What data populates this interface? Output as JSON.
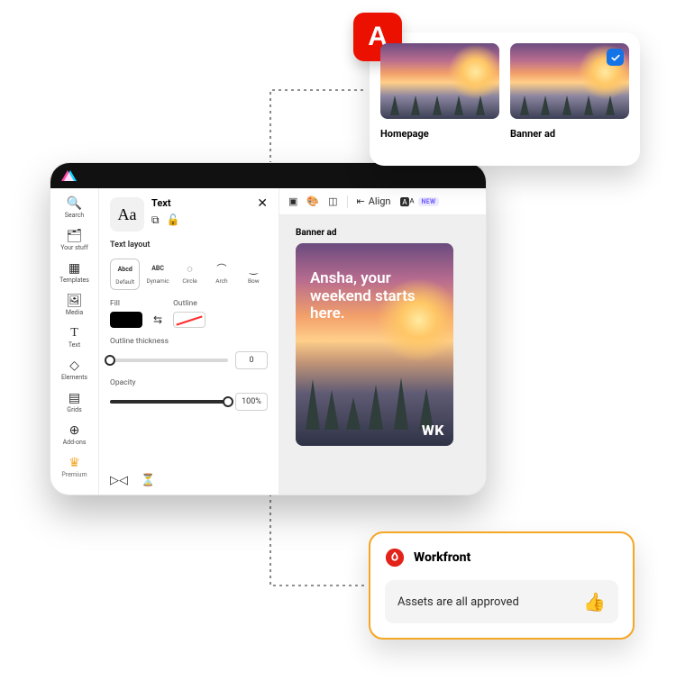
{
  "rail": [
    {
      "icon": "🔍",
      "label": "Search",
      "name": "search"
    },
    {
      "icon": "🗂",
      "label": "Your stuff",
      "name": "your-stuff"
    },
    {
      "icon": "▦",
      "label": "Templates",
      "name": "templates"
    },
    {
      "icon": "🖼",
      "label": "Media",
      "name": "media"
    },
    {
      "icon": "T",
      "label": "Text",
      "name": "text"
    },
    {
      "icon": "◇",
      "label": "Elements",
      "name": "elements"
    },
    {
      "icon": "▤",
      "label": "Grids",
      "name": "grids"
    },
    {
      "icon": "⊕",
      "label": "Add-ons",
      "name": "add-ons"
    },
    {
      "icon": "♛",
      "label": "Premium",
      "name": "premium",
      "premium": true
    }
  ],
  "panel": {
    "icon": "Aa",
    "title": "Text",
    "layout_label": "Text layout",
    "layouts": [
      {
        "name": "Default",
        "sym": "Abcd",
        "selected": true
      },
      {
        "name": "Dynamic",
        "sym": "ABC"
      },
      {
        "name": "Circle",
        "sym": "◌"
      },
      {
        "name": "Arch",
        "sym": "⌒"
      },
      {
        "name": "Bow",
        "sym": "‿"
      }
    ],
    "fill_label": "Fill",
    "outline_label": "Outline",
    "fill_color": "#000000",
    "outline_color": "none",
    "thickness_label": "Outline thickness",
    "thickness_value": "0",
    "thickness_percent": 0,
    "opacity_label": "Opacity",
    "opacity_value": "100%",
    "opacity_percent": 100
  },
  "toolbar": {
    "align_label": "Align",
    "translate_label": "NEW"
  },
  "canvas": {
    "label": "Banner ad",
    "headline": "Ansha, your weekend starts here.",
    "brand": "WK"
  },
  "cards": {
    "items": [
      {
        "caption": "Homepage",
        "selected": false
      },
      {
        "caption": "Banner ad",
        "selected": true
      }
    ]
  },
  "workfront": {
    "title": "Workfront",
    "message": "Assets are all approved",
    "emoji": "👍"
  }
}
